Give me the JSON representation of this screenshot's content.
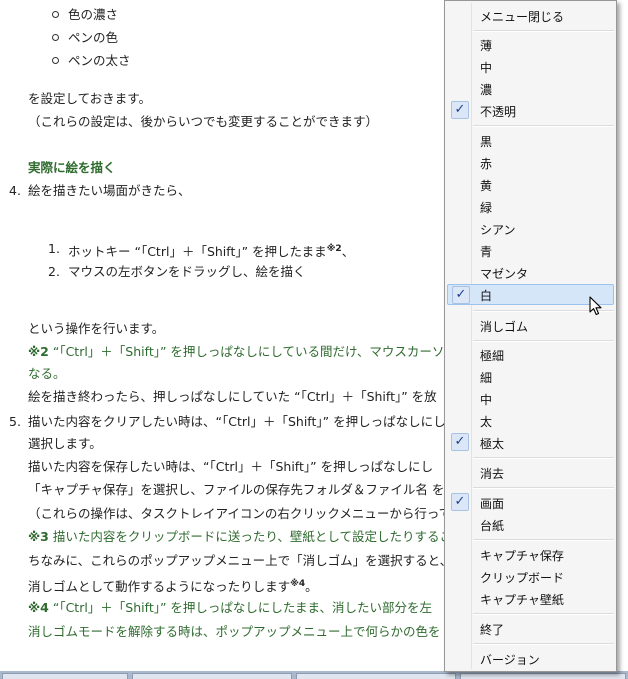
{
  "document": {
    "settings_items": [
      "色の濃さ",
      "ペンの色",
      "ペンの太さ"
    ],
    "configure_text": "を設定しておきます。",
    "configure_note": "（これらの設定は、後からいつでも変更することができます）",
    "section_title": "実際に絵を描く",
    "step4_num": "4.",
    "step4_text": "絵を描きたい場面がきたら、",
    "sub1_num": "1.",
    "sub1_text": "ホットキー “「Ctrl」＋「Shift」” を押したまま",
    "sub1_sup": "※2",
    "sub1_tail": "、",
    "sub2_num": "2.",
    "sub2_text": "マウスの左ボタンをドラッグし、絵を描く",
    "operation_text": "という操作を行います。",
    "note2_mark": "※2",
    "note2_text": "“「Ctrl」＋「Shift」” を押しっぱなしにしている間だけ、マウスカーソ",
    "note2_cont": "なる。",
    "after_draw": "絵を描き終わったら、押しっぱなしにしていた “「Ctrl」＋「Shift」” を放",
    "step5_num": "5.",
    "step5_text": "描いた内容をクリアしたい時は、“「Ctrl」＋「Shift」” を押しっぱなしにし",
    "step5_cont": "選択します。",
    "save_text": "描いた内容を保存したい時は、“「Ctrl」＋「Shift」” を押しっぱなしにし",
    "capture_text": "「キャプチャ保存」を選択し、ファイルの保存先フォルダ＆ファイル名 を",
    "ops_note": "（これらの操作は、タスクトレイアイコンの右クリックメニューから行っても",
    "note3_mark": "※3",
    "note3_text": "描いた内容をクリップボードに送ったり、壁紙として設定したりするこ",
    "eraser_line": "ちなみに、これらのポップアップメニュー上で「消しゴム」を選択すると、",
    "eraser_mode": "消しゴムとして動作するようになったりします",
    "eraser_sup": "※4",
    "eraser_tail": "。",
    "note4_mark": "※4",
    "note4_text": "“「Ctrl」＋「Shift」” を押しっぱなしにしたまま、消したい部分を左",
    "note4_cont": "消しゴムモードを解除する時は、ポップアップメニュー上で何らかの色を"
  },
  "menu": {
    "close": "メニュー閉じる",
    "opacity": [
      "薄",
      "中",
      "濃",
      "不透明"
    ],
    "colors": [
      "黒",
      "赤",
      "黄",
      "緑",
      "シアン",
      "青",
      "マゼンタ",
      "白"
    ],
    "eraser": "消しゴム",
    "widths": [
      "極細",
      "細",
      "中",
      "太",
      "極太"
    ],
    "clear": "消去",
    "targets": [
      "画面",
      "台紙"
    ],
    "capture": [
      "キャプチャ保存",
      "クリップボード",
      "キャプチャ壁紙"
    ],
    "exit": "終了",
    "version": "バージョン",
    "checked": [
      "不透明",
      "白",
      "極太",
      "画面"
    ]
  },
  "icons": {
    "check": "checkmark-icon",
    "cursor": "mouse-pointer-icon"
  },
  "colors": {
    "green_text": "#2f6b2f",
    "menu_highlight": "#d6e6f9",
    "check_blue": "#1d3f8f"
  }
}
